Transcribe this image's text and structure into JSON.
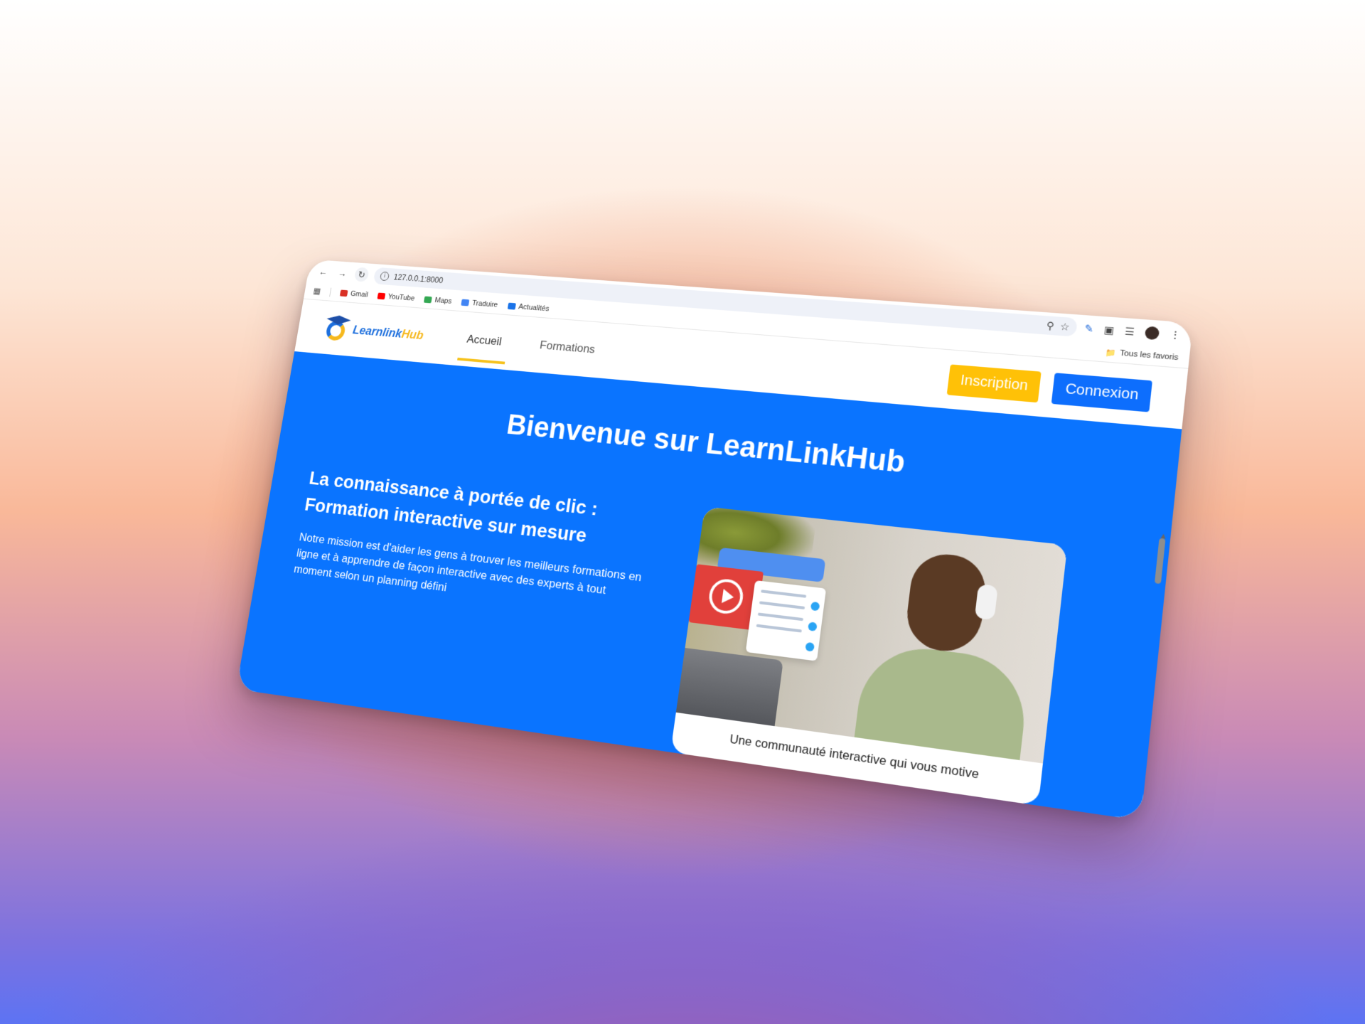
{
  "browser": {
    "url": "127.0.0.1:8000",
    "bookmarks": [
      {
        "label": "Gmail",
        "color": "#d93025"
      },
      {
        "label": "YouTube",
        "color": "#ff0000"
      },
      {
        "label": "Maps",
        "color": "#34a853"
      },
      {
        "label": "Traduire",
        "color": "#4285f4"
      },
      {
        "label": "Actualités",
        "color": "#1a73e8"
      }
    ],
    "all_bookmarks_label": "Tous les favoris"
  },
  "site": {
    "logo": {
      "part1": "Learnlink",
      "part2": "Hub"
    },
    "nav": [
      {
        "label": "Accueil",
        "active": true
      },
      {
        "label": "Formations",
        "active": false
      }
    ],
    "buttons": {
      "signup": "Inscription",
      "login": "Connexion"
    }
  },
  "hero": {
    "title": "Bienvenue sur LearnLinkHub",
    "subtitle": "La connaissance à portée de clic : Formation interactive sur mesure",
    "text": "Notre mission est d'aider les gens à trouver les meilleurs formations en ligne et à apprendre de façon interactive avec des experts à tout moment selon un planning défini",
    "card_caption": "Une communauté interactive qui vous motive"
  },
  "colors": {
    "primary": "#0a74ff",
    "accent": "#ffc107",
    "button_blue": "#0d6efd"
  }
}
